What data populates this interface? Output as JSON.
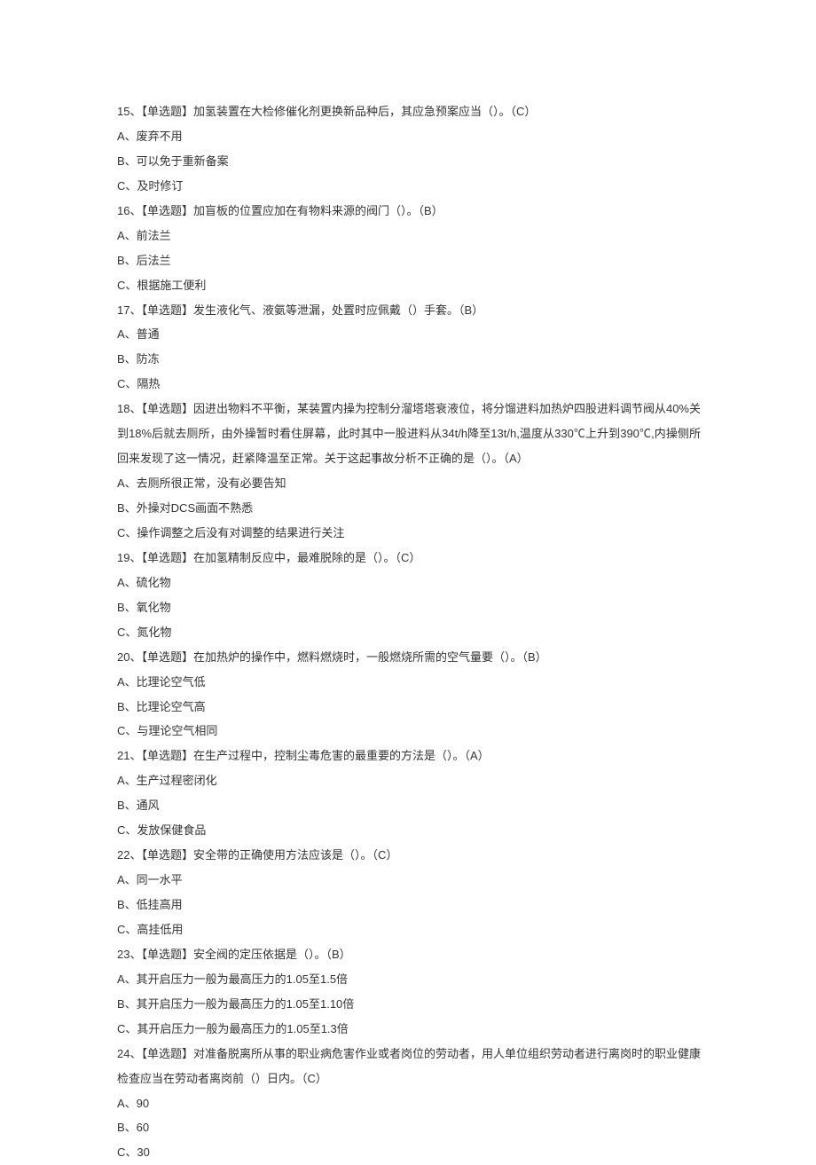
{
  "lines": [
    "15、【单选题】加氢装置在大检修催化剂更换新品种后，其应急预案应当（）。（C）",
    "A、废弃不用",
    "B、可以免于重新备案",
    "C、及时修订",
    "16、【单选题】加盲板的位置应加在有物料来源的阀门（）。（B）",
    "A、前法兰",
    "B、后法兰",
    "C、根据施工便利",
    "17、【单选题】发生液化气、液氨等泄漏，处置时应佩戴（）手套。（B）",
    "A、普通",
    "B、防冻",
    "C、隔热",
    "18、【单选题】因进出物料不平衡，某装置内操为控制分溜塔塔衰液位，将分馏进料加热炉四股进料调节阀从40%关到18%后就去厕所，由外操暂时看住屏幕，此时其中一股进料从34t/h降至13t/h,温度从330℃上升到390℃,内操侧所回来发现了这一情况，赶紧降温至正常。关于这起事故分析不正确的是（）。（A）",
    "A、去厕所很正常，没有必要告知",
    "B、外操对DCS画面不熟悉",
    "C、操作调整之后没有对调整的结果进行关注",
    "19、【单选题】在加氢精制反应中，最难脱除的是（）。（C）",
    "A、硫化物",
    "B、氧化物",
    "C、氮化物",
    "20、【单选题】在加热炉的操作中，燃料燃烧时，一般燃烧所需的空气量要（）。（B）",
    "A、比理论空气低",
    "B、比理论空气高",
    "C、与理论空气相同",
    "21、【单选题】在生产过程中，控制尘毒危害的最重要的方法是（）。（A）",
    "A、生产过程密闭化",
    "B、通风",
    "C、发放保健食品",
    "22、【单选题】安全带的正确使用方法应该是（）。（C）",
    "A、同一水平",
    "B、低挂高用",
    "C、高挂低用",
    "23、【单选题】安全阀的定压依据是（）。（B）",
    "A、其开启压力一般为最高压力的1.05至1.5倍",
    "B、其开启压力一般为最高压力的1.05至1.10倍",
    "C、其开启压力一般为最高压力的1.05至1.3倍",
    "24、【单选题】对准备脱离所从事的职业病危害作业或者岗位的劳动者，用人单位组织劳动者进行离岗时的职业健康检查应当在劳动者离岗前（）日内。（C）",
    "A、90",
    "B、60",
    "C、30"
  ]
}
